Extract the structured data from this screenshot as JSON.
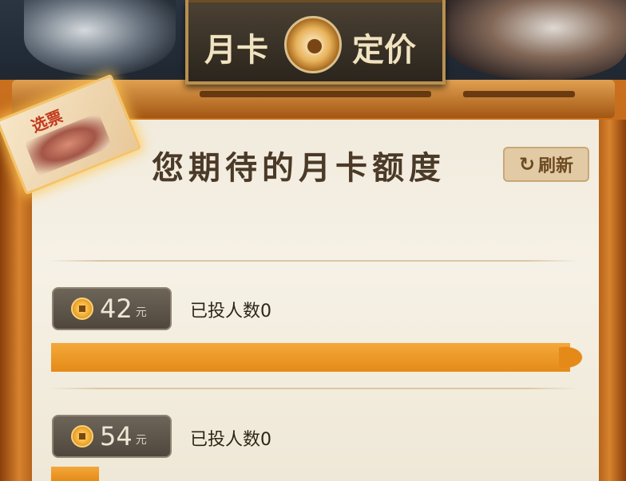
{
  "banner": {
    "title_left": "月卡",
    "title_right": "定价"
  },
  "ticket": {
    "label": "选票"
  },
  "main": {
    "heading": "您期待的月卡额度",
    "refresh_label": "刷新"
  },
  "options": [
    {
      "amount": "42",
      "unit": "元",
      "votes_label": "已投人数0"
    },
    {
      "amount": "54",
      "unit": "元",
      "votes_label": "已投人数0"
    }
  ],
  "colors": {
    "accent": "#e58a18",
    "frame": "#c9701f",
    "paper": "#f3eddf",
    "badge": "#5b5247"
  }
}
